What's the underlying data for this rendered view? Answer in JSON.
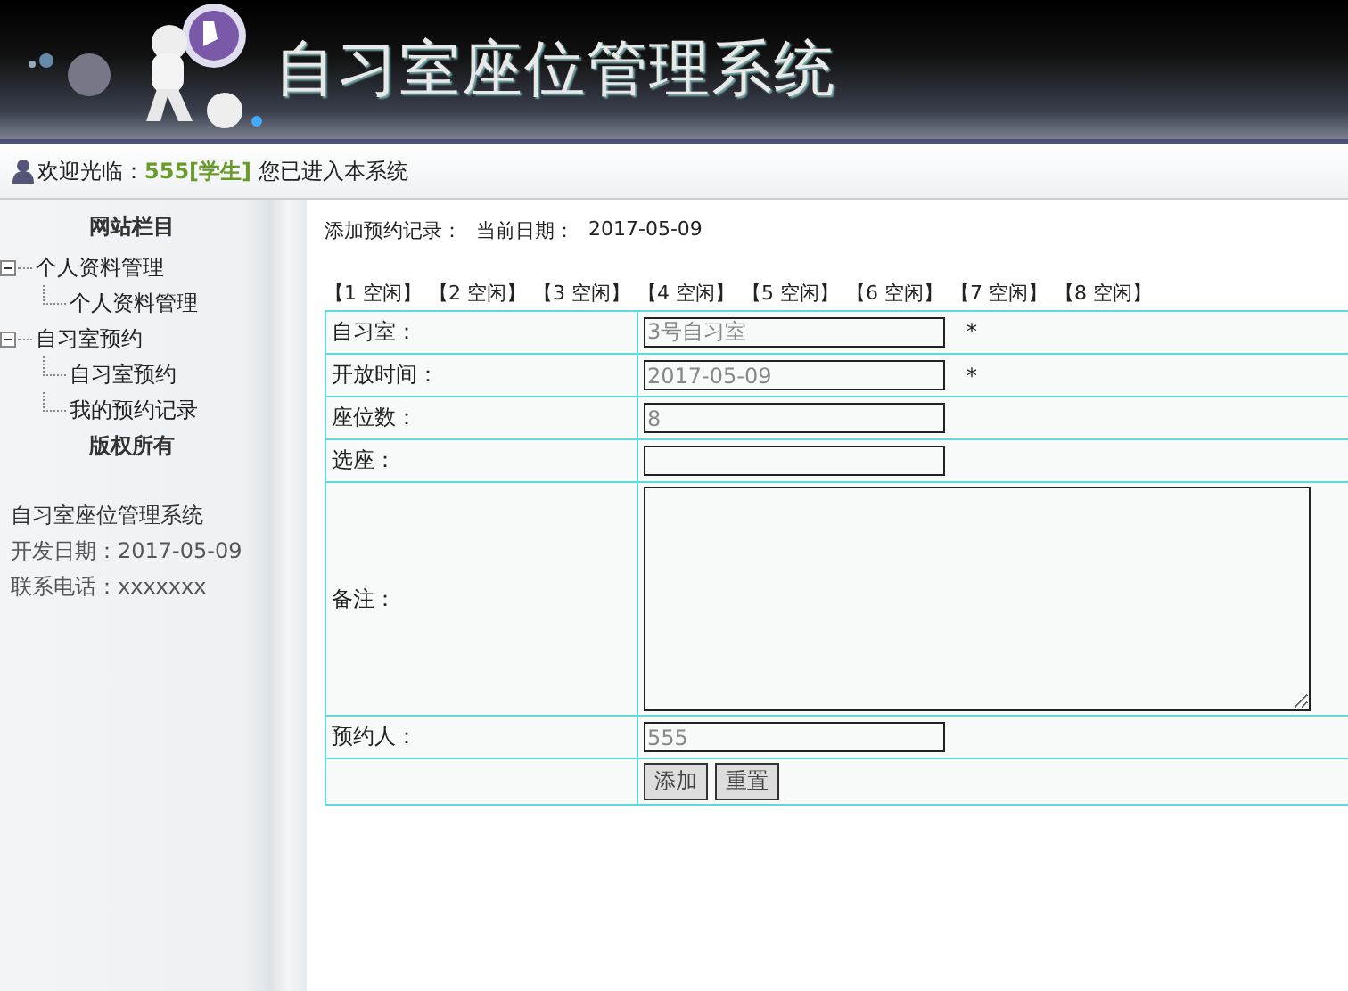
{
  "header": {
    "title": "自习室座位管理系统"
  },
  "welcome": {
    "prefix": "欢迎光临：",
    "user": "555[学生]",
    "suffix": "您已进入本系统"
  },
  "sidebar": {
    "heading": "网站栏目",
    "tree": [
      {
        "label": "个人资料管理",
        "expanded": true,
        "children": [
          {
            "label": "个人资料管理"
          }
        ]
      },
      {
        "label": "自习室预约",
        "expanded": true,
        "children": [
          {
            "label": "自习室预约"
          },
          {
            "label": "我的预约记录"
          }
        ]
      }
    ],
    "copyright_heading": "版权所有",
    "info": [
      "自习室座位管理系统",
      "开发日期：2017-05-09",
      "联系电话：xxxxxxx"
    ]
  },
  "main": {
    "heading": "添加预约记录：",
    "date_label": "当前日期：",
    "date": "2017-05-09",
    "seats": [
      "【1 空闲】",
      "【2 空闲】",
      "【3 空闲】",
      "【4 空闲】",
      "【5 空闲】",
      "【6 空闲】",
      "【7 空闲】",
      "【8 空闲】"
    ],
    "form": [
      {
        "label": "自习室：",
        "kind": "input",
        "value": "3号自习室",
        "readonly": true,
        "required_mark": "*"
      },
      {
        "label": "开放时间：",
        "kind": "input",
        "value": "2017-05-09",
        "readonly": true,
        "required_mark": "*"
      },
      {
        "label": "座位数：",
        "kind": "input",
        "value": "8",
        "readonly": true
      },
      {
        "label": "选座：",
        "kind": "input"
      },
      {
        "label": "备注：",
        "kind": "textarea"
      },
      {
        "label": "预约人：",
        "kind": "input",
        "value": "555",
        "readonly": true
      }
    ],
    "buttons": [
      "添加",
      "重置"
    ]
  }
}
